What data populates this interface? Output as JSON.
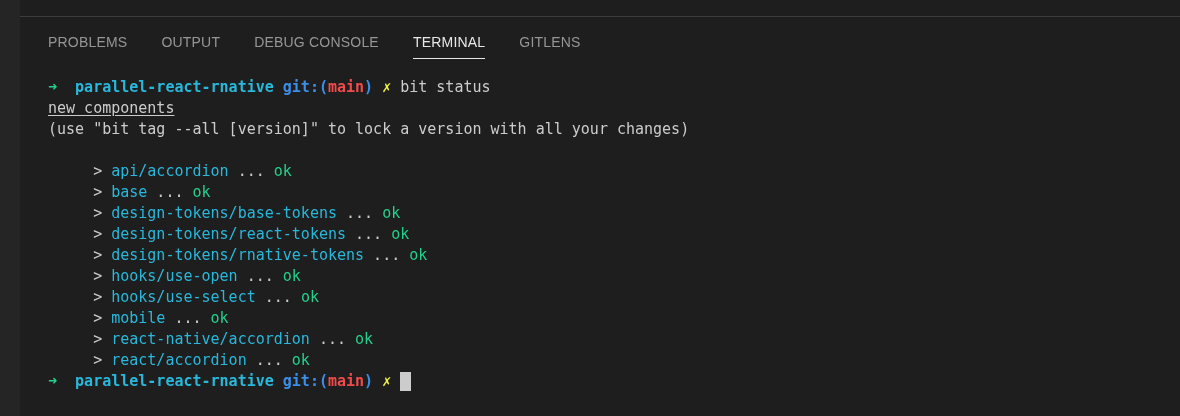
{
  "tabs": [
    {
      "label": "PROBLEMS",
      "selected": false
    },
    {
      "label": "OUTPUT",
      "selected": false
    },
    {
      "label": "DEBUG CONSOLE",
      "selected": false
    },
    {
      "label": "TERMINAL",
      "selected": true
    },
    {
      "label": "GITLENS",
      "selected": false
    }
  ],
  "terminal": {
    "prompt": {
      "arrow": "➜",
      "directory": "parallel-react-rnative",
      "git_label": "git:(",
      "branch": "main",
      "git_close": ")",
      "dirty_mark": "✗",
      "command": "bit status"
    },
    "heading": "new components",
    "hint": "(use \"bit tag --all [version]\" to lock a version with all your changes)",
    "components": [
      {
        "marker": ">",
        "name": "api/accordion",
        "dots": "...",
        "status": "ok"
      },
      {
        "marker": ">",
        "name": "base",
        "dots": "...",
        "status": "ok"
      },
      {
        "marker": ">",
        "name": "design-tokens/base-tokens",
        "dots": "...",
        "status": "ok"
      },
      {
        "marker": ">",
        "name": "design-tokens/react-tokens",
        "dots": "...",
        "status": "ok"
      },
      {
        "marker": ">",
        "name": "design-tokens/rnative-tokens",
        "dots": "...",
        "status": "ok"
      },
      {
        "marker": ">",
        "name": "hooks/use-open",
        "dots": "...",
        "status": "ok"
      },
      {
        "marker": ">",
        "name": "hooks/use-select",
        "dots": "...",
        "status": "ok"
      },
      {
        "marker": ">",
        "name": "mobile",
        "dots": "...",
        "status": "ok"
      },
      {
        "marker": ">",
        "name": "react-native/accordion",
        "dots": "...",
        "status": "ok"
      },
      {
        "marker": ">",
        "name": "react/accordion",
        "dots": "...",
        "status": "ok"
      }
    ],
    "final_prompt": {
      "arrow": "➜",
      "directory": "parallel-react-rnative",
      "git_label": "git:(",
      "branch": "main",
      "git_close": ")",
      "dirty_mark": "✗"
    }
  }
}
